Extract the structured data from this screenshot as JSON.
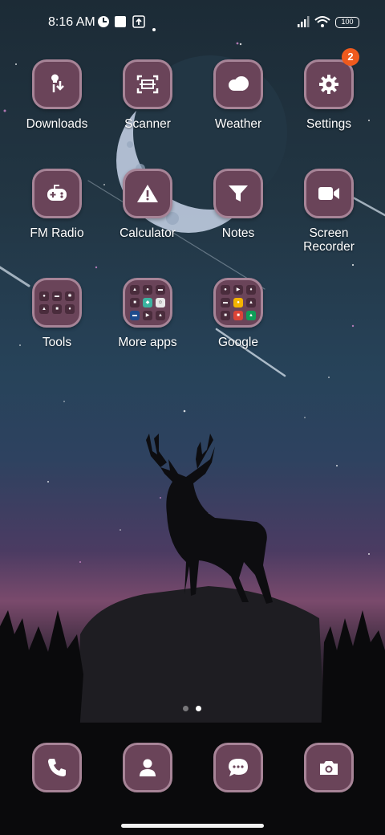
{
  "status_bar": {
    "time": "8:16 AM",
    "battery": "100",
    "icons": [
      "vpn-icon",
      "square-notification-icon",
      "upload-icon",
      "signal-icon",
      "wifi-icon",
      "battery-icon"
    ]
  },
  "apps": [
    {
      "label": "Downloads",
      "icon": "download-icon"
    },
    {
      "label": "Scanner",
      "icon": "scanner-icon"
    },
    {
      "label": "Weather",
      "icon": "cloud-icon"
    },
    {
      "label": "Settings",
      "icon": "gear-icon",
      "badge": "2"
    },
    {
      "label": "FM Radio",
      "icon": "gamepad-icon"
    },
    {
      "label": "Calculator",
      "icon": "warning-icon"
    },
    {
      "label": "Notes",
      "icon": "filter-icon"
    },
    {
      "label": "Screen Recorder",
      "icon": "video-icon"
    }
  ],
  "folders": [
    {
      "label": "Tools"
    },
    {
      "label": "More apps"
    },
    {
      "label": "Google"
    }
  ],
  "dock": [
    {
      "icon": "phone-icon"
    },
    {
      "icon": "contacts-icon"
    },
    {
      "icon": "messages-icon"
    },
    {
      "icon": "camera-icon"
    }
  ],
  "colors": {
    "tile": "#6a4459",
    "tile_border": "#a78497",
    "badge": "#ef5a1d"
  },
  "page_indicator": {
    "count": 2,
    "active": 2
  }
}
